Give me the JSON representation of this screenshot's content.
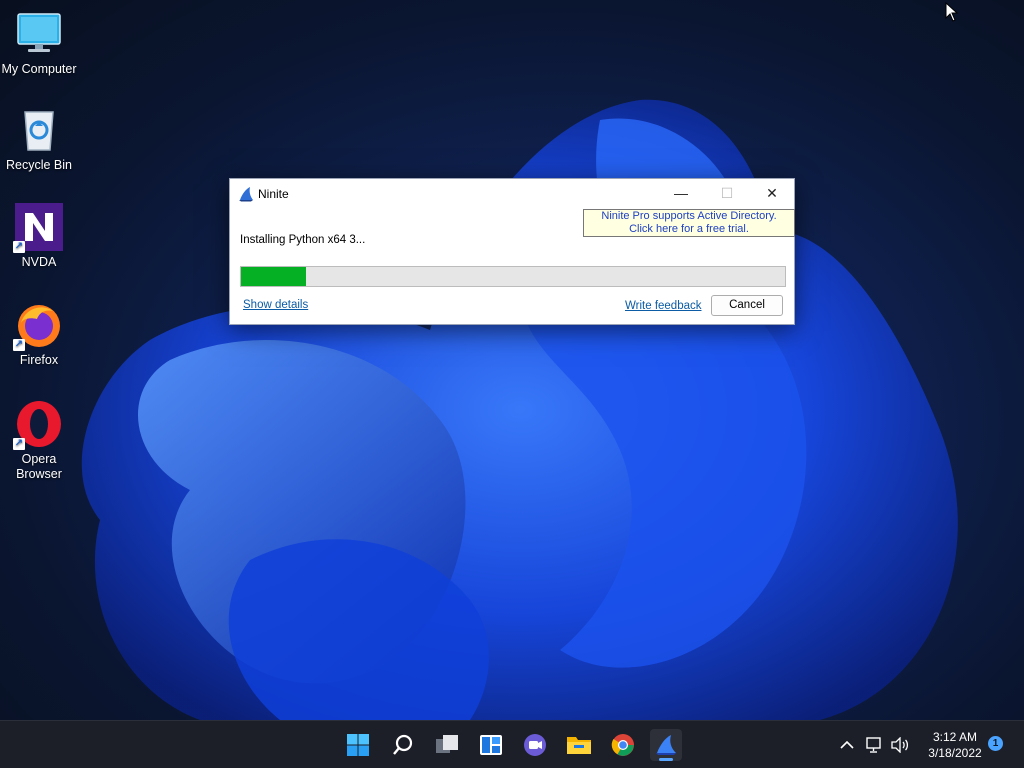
{
  "desktop": {
    "icons": [
      {
        "label": "My Computer"
      },
      {
        "label": "Recycle Bin"
      },
      {
        "label": "NVDA"
      },
      {
        "label": "Firefox"
      },
      {
        "label": "Opera Browser"
      }
    ]
  },
  "dialog": {
    "title": "Ninite",
    "promo_line1": "Ninite Pro supports Active Directory.",
    "promo_line2": "Click here for a free trial.",
    "status": "Installing Python x64 3...",
    "progress": 0.12,
    "show_details": "Show details",
    "write_feedback": "Write feedback",
    "cancel": "Cancel",
    "minimize_glyph": "—",
    "maximize_glyph": "☐",
    "close_glyph": "✕"
  },
  "taskbar": {
    "apps": [
      "start-icon",
      "search-icon",
      "task-view-icon",
      "widgets-icon",
      "teams-chat-icon",
      "file-explorer-icon",
      "chrome-icon",
      "ninite-icon"
    ],
    "time": "3:12 AM",
    "date": "3/18/2022",
    "notification_count": "1"
  },
  "colors": {
    "progress_fill": "#06b025",
    "promo_bg": "#ffffe1",
    "link": "#0b5ba5"
  }
}
